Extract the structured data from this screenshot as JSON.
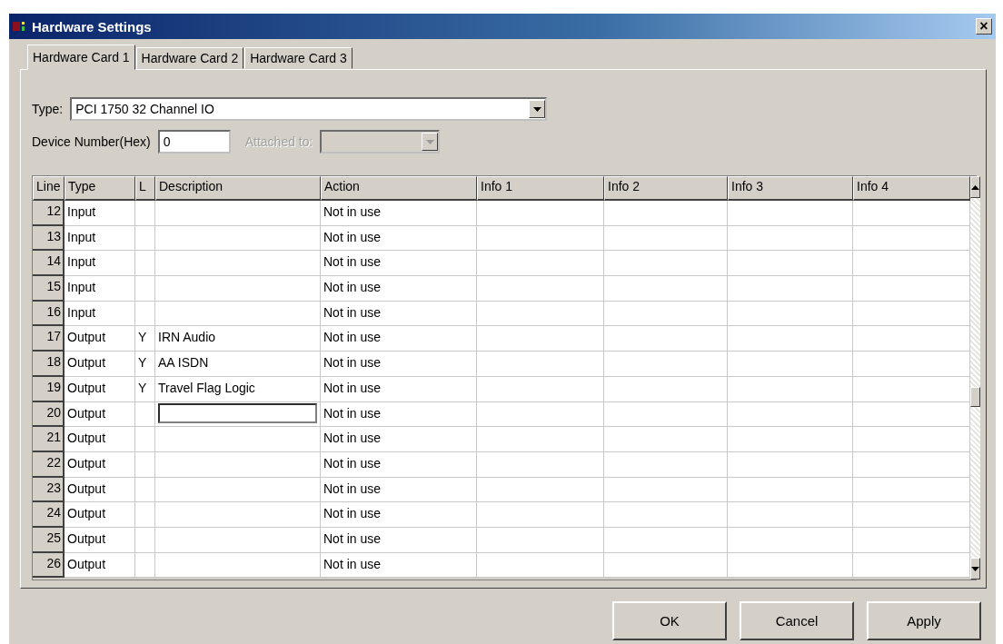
{
  "window": {
    "title": "Hardware Settings",
    "close": "×"
  },
  "tabs": [
    {
      "label": "Hardware Card 1",
      "selected": true
    },
    {
      "label": "Hardware Card 2",
      "selected": false
    },
    {
      "label": "Hardware Card 3",
      "selected": false
    }
  ],
  "type_field": {
    "label": "Type:",
    "value": "PCI 1750 32 Channel IO"
  },
  "device_number": {
    "label": "Device Number(Hex)",
    "value": "0"
  },
  "attached_to": {
    "label": "Attached to:",
    "disabled": true
  },
  "table": {
    "columns": [
      "Line",
      "Type",
      "L",
      "Description",
      "Action",
      "Info 1",
      "Info 2",
      "Info 3",
      "Info 4"
    ],
    "rows": [
      {
        "line": "12",
        "type": "Input",
        "action": "Not in use",
        "editing": false
      },
      {
        "line": "13",
        "type": "Input",
        "action": "Not in use",
        "editing": false
      },
      {
        "line": "14",
        "type": "Input",
        "action": "Not in use",
        "editing": false
      },
      {
        "line": "15",
        "type": "Input",
        "action": "Not in use",
        "editing": false
      },
      {
        "line": "16",
        "type": "Input",
        "action": "Not in use",
        "editing": false
      },
      {
        "line": "17",
        "type": "Output",
        "l": "Y",
        "description": "IRN Audio",
        "action": "Not in use",
        "editing": false
      },
      {
        "line": "18",
        "type": "Output",
        "l": "Y",
        "description": "AA ISDN",
        "action": "Not in use",
        "editing": false
      },
      {
        "line": "19",
        "type": "Output",
        "l": "Y",
        "description": "Travel Flag Logic",
        "action": "Not in use",
        "editing": false
      },
      {
        "line": "20",
        "type": "Output",
        "action": "Not in use",
        "editing": true
      },
      {
        "line": "21",
        "type": "Output",
        "action": "Not in use",
        "editing": false
      },
      {
        "line": "22",
        "type": "Output",
        "action": "Not in use",
        "editing": false
      },
      {
        "line": "23",
        "type": "Output",
        "action": "Not in use",
        "editing": false
      },
      {
        "line": "24",
        "type": "Output",
        "action": "Not in use",
        "editing": false
      },
      {
        "line": "25",
        "type": "Output",
        "action": "Not in use",
        "editing": false
      },
      {
        "line": "26",
        "type": "Output",
        "action": "Not in use",
        "editing": false
      }
    ]
  },
  "buttons": [
    "OK",
    "Cancel",
    "Apply"
  ]
}
